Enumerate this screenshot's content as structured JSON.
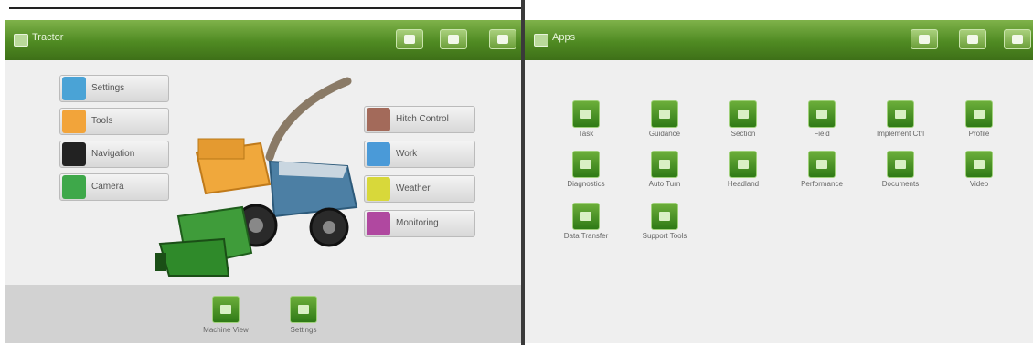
{
  "left_window": {
    "title": "Tractor",
    "title_buttons": [
      "window-a-icon",
      "window-b-icon",
      "window-c-icon"
    ],
    "left_buttons": [
      {
        "label": "Settings",
        "color": "#4aa3d6",
        "icon": "settings-icon"
      },
      {
        "label": "Tools",
        "color": "#f2a43a",
        "icon": "tools-icon"
      },
      {
        "label": "Navigation",
        "color": "#222222",
        "icon": "navigation-icon"
      },
      {
        "label": "Camera",
        "color": "#3ea84a",
        "icon": "camera-icon"
      }
    ],
    "right_buttons": [
      {
        "label": "Hitch Control",
        "color": "#a36a5a",
        "icon": "hitch-icon"
      },
      {
        "label": "Work",
        "color": "#4a9ad8",
        "icon": "work-icon"
      },
      {
        "label": "Weather",
        "color": "#d8d83a",
        "icon": "weather-icon"
      },
      {
        "label": "Monitoring",
        "color": "#b048a0",
        "icon": "monitoring-icon"
      }
    ],
    "bottom_icons": [
      {
        "label": "Machine View"
      },
      {
        "label": "Settings"
      }
    ]
  },
  "right_window": {
    "title": "Apps",
    "title_buttons": [
      "window-a-icon",
      "window-b-icon",
      "window-c-icon"
    ],
    "apps": [
      {
        "label": "Task"
      },
      {
        "label": "Guidance"
      },
      {
        "label": "Section"
      },
      {
        "label": "Field"
      },
      {
        "label": "Implement Ctrl"
      },
      {
        "label": "Profile"
      },
      {
        "label": "Diagnostics"
      },
      {
        "label": "Auto Turn"
      },
      {
        "label": "Headland"
      },
      {
        "label": "Performance"
      },
      {
        "label": "Documents"
      },
      {
        "label": "Video"
      },
      {
        "label": "Data Transfer"
      },
      {
        "label": "Support Tools"
      }
    ]
  },
  "colors": {
    "accent": "#4f8a22",
    "panel_bg": "#efefef"
  }
}
